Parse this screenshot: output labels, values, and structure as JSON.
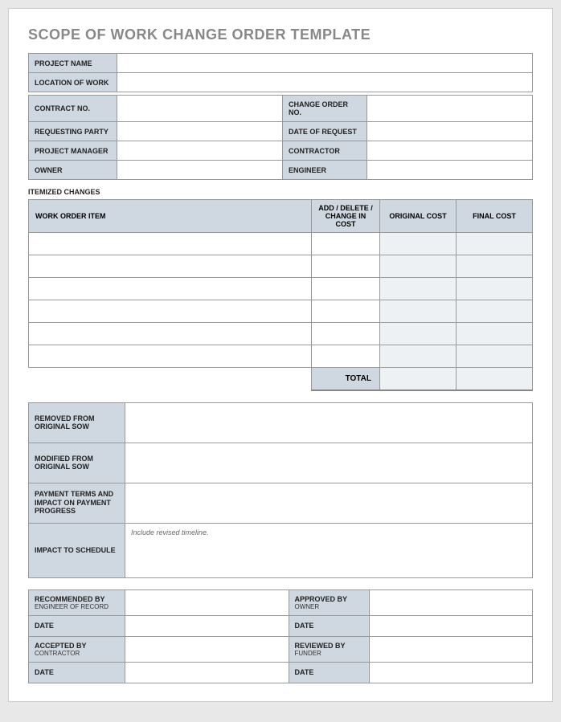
{
  "title": "SCOPE OF WORK CHANGE ORDER TEMPLATE",
  "header": {
    "project_name_label": "PROJECT NAME",
    "project_name": "",
    "location_label": "LOCATION OF WORK",
    "location": "",
    "contract_no_label": "CONTRACT NO.",
    "contract_no": "",
    "change_order_no_label": "CHANGE ORDER NO.",
    "change_order_no": "",
    "requesting_party_label": "REQUESTING PARTY",
    "requesting_party": "",
    "date_of_request_label": "DATE OF REQUEST",
    "date_of_request": "",
    "project_manager_label": "PROJECT MANAGER",
    "project_manager": "",
    "contractor_label": "CONTRACTOR",
    "contractor": "",
    "owner_label": "OWNER",
    "owner": "",
    "engineer_label": "ENGINEER",
    "engineer": ""
  },
  "itemized": {
    "heading": "ITEMIZED CHANGES",
    "cols": {
      "item": "WORK ORDER ITEM",
      "change": "ADD / DELETE / CHANGE IN COST",
      "original": "ORIGINAL COST",
      "final": "FINAL COST"
    },
    "rows": [
      {
        "item": "",
        "change": "",
        "original": "",
        "final": ""
      },
      {
        "item": "",
        "change": "",
        "original": "",
        "final": ""
      },
      {
        "item": "",
        "change": "",
        "original": "",
        "final": ""
      },
      {
        "item": "",
        "change": "",
        "original": "",
        "final": ""
      },
      {
        "item": "",
        "change": "",
        "original": "",
        "final": ""
      },
      {
        "item": "",
        "change": "",
        "original": "",
        "final": ""
      }
    ],
    "total_label": "TOTAL",
    "total_original": "",
    "total_final": ""
  },
  "narrative": {
    "removed_label": "REMOVED FROM ORIGINAL SOW",
    "removed": "",
    "modified_label": "MODIFIED FROM ORIGINAL SOW",
    "modified": "",
    "payment_label": "PAYMENT TERMS AND IMPACT ON PAYMENT PROGRESS",
    "payment": "",
    "schedule_label": "IMPACT TO SCHEDULE",
    "schedule_hint": "Include revised timeline.",
    "schedule": ""
  },
  "signatures": {
    "recommended_label": "RECOMMENDED BY",
    "recommended_sub": "ENGINEER OF RECORD",
    "recommended": "",
    "approved_label": "APPROVED BY",
    "approved_sub": "OWNER",
    "approved": "",
    "date_label": "DATE",
    "recommended_date": "",
    "approved_date": "",
    "accepted_label": "ACCEPTED BY",
    "accepted_sub": "CONTRACTOR",
    "accepted": "",
    "reviewed_label": "REVIEWED BY",
    "reviewed_sub": "FUNDER",
    "reviewed": "",
    "accepted_date": "",
    "reviewed_date": ""
  }
}
